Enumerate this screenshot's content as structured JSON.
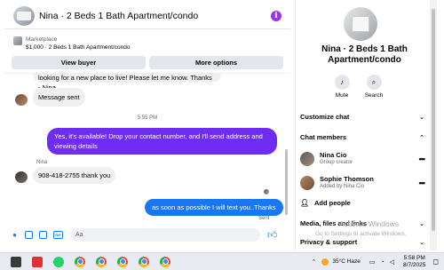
{
  "header": {
    "title": "Nina · 2 Beds 1 Bath Apartment/condo",
    "info_icon": "i"
  },
  "listing": {
    "label": "Marketplace",
    "detail": "$1,000 · 2 Beds 1 Bath Apartment/condo"
  },
  "actions": {
    "view_buyer": "View buyer",
    "more_options": "More options"
  },
  "messages": {
    "cut_text": "looking for a new place to live! Please let me know. Thanks - Nina",
    "message_sent": "Message sent",
    "timestamp": "5:55 PM",
    "out1_line1": "Yes, it's available! Drop your contact number, and I'll send address and",
    "out1_line2": "viewing details",
    "sender": "Nina",
    "in_phone": "908-418-2755 thank you",
    "out2": "as soon as possible I will text you..Thanks",
    "sent": "Sent"
  },
  "composer": {
    "placeholder": "Aa"
  },
  "details": {
    "title_line1": "Nina · 2 Beds 1 Bath",
    "title_line2": "Apartment/condo",
    "mute": "Mute",
    "search": "Search",
    "customize_chat": "Customize chat",
    "chat_members": "Chat members",
    "members": [
      {
        "name": "Nina Cio",
        "sub": "Group creator"
      },
      {
        "name": "Sophie Thomson",
        "sub": "Added by Nina Cio"
      }
    ],
    "add_people": "Add people",
    "media_files_links": "Media, files and links",
    "privacy_support": "Privacy & support"
  },
  "watermark": {
    "line1": "Activate Windows",
    "line2": "Go to Settings to activate Windows."
  },
  "taskbar": {
    "temperature": "35°C",
    "weather": "Haze",
    "time": "5:58 PM",
    "date": "8/7/2025"
  },
  "colors": {
    "purple_bubble": "#6f2cf3",
    "blue_bubble": "#1877f2",
    "accent_purple": "#9b34ef"
  }
}
